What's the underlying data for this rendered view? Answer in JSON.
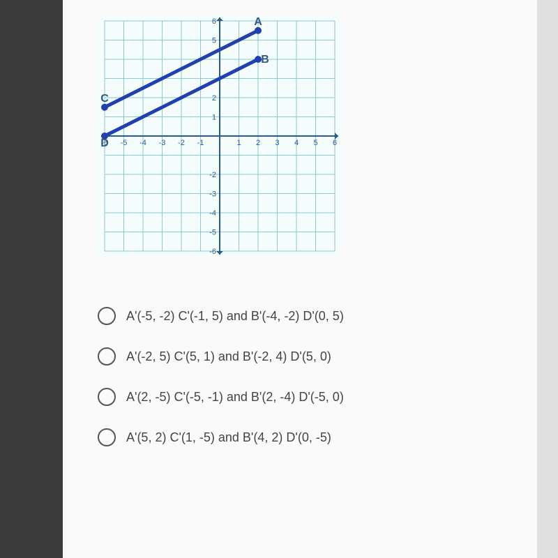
{
  "chart_data": {
    "type": "scatter",
    "xlim": [
      -6,
      6
    ],
    "ylim": [
      -6,
      6
    ],
    "xlabel": "",
    "ylabel": "",
    "x_ticks": [
      -6,
      -5,
      -4,
      -3,
      -2,
      -1,
      1,
      2,
      3,
      4,
      5,
      6
    ],
    "y_ticks": [
      -6,
      -5,
      -4,
      -3,
      -2,
      1,
      2,
      5,
      6
    ],
    "points": [
      {
        "name": "A",
        "x": 2,
        "y": 5.5,
        "label_dx": 0,
        "label_dy": -8
      },
      {
        "name": "B",
        "x": 2,
        "y": 4,
        "label_dx": 10,
        "label_dy": 5
      },
      {
        "name": "C",
        "x": -6,
        "y": 1.5,
        "label_dx": 0,
        "label_dy": -8
      },
      {
        "name": "D",
        "x": -6,
        "y": 0,
        "label_dx": 0,
        "label_dy": 15
      }
    ],
    "segments": [
      {
        "from": "A",
        "to": "C"
      },
      {
        "from": "B",
        "to": "D"
      }
    ]
  },
  "options": [
    "A'(-5, -2)  C'(-1, 5) and B'(-4, -2) D'(0, 5)",
    "A'(-2, 5)  C'(5, 1) and B'(-2, 4) D'(5, 0)",
    "A'(2, -5)  C'(-5, -1) and B'(2, -4) D'(-5, 0)",
    "A'(5, 2)  C'(1, -5) and B'(4, 2) D'(0, -5)"
  ]
}
